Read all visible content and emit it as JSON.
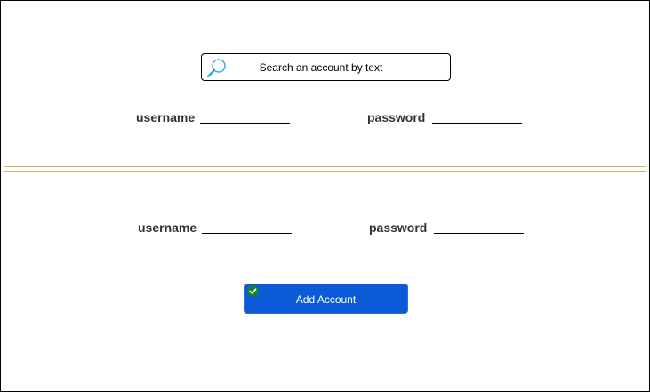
{
  "search": {
    "placeholder": "Search an account by text",
    "icon": "search-icon"
  },
  "top_form": {
    "username_label": "username",
    "password_label": "password"
  },
  "bottom_form": {
    "username_label": "username",
    "password_label": "password"
  },
  "add_button": {
    "label": "Add Account",
    "icon": "check-circle-icon"
  },
  "colors": {
    "accent": "#0b5bd7",
    "divider": "#c9b36b",
    "check_badge": "#1a7f37",
    "search_icon": "#1ba1e2"
  }
}
